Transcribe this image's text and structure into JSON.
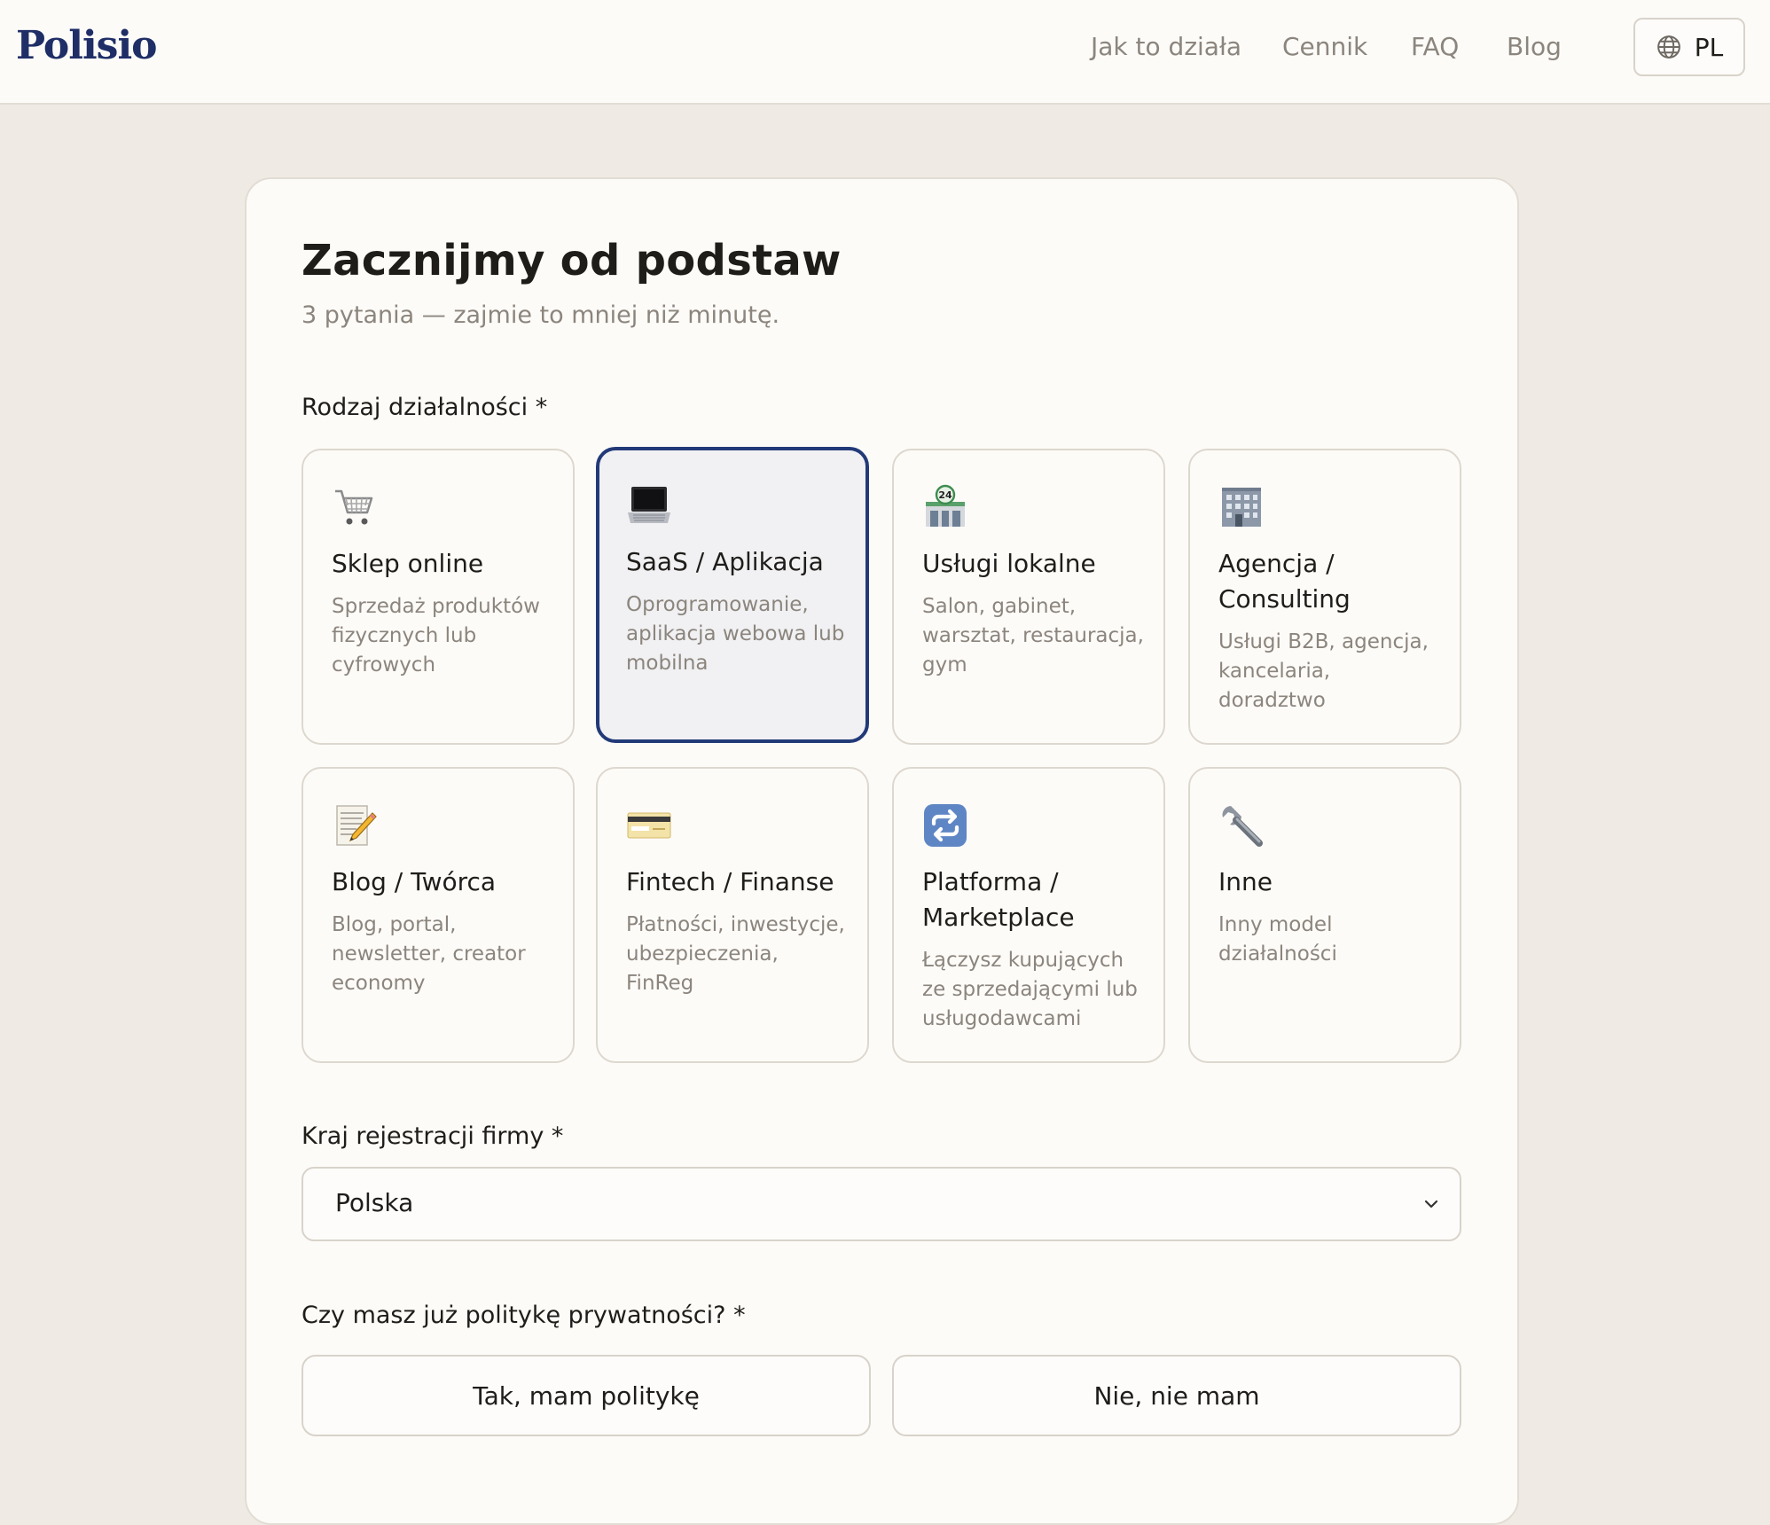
{
  "header": {
    "logo": "Polisio",
    "nav": [
      "Jak to działa",
      "Cennik",
      "FAQ",
      "Blog"
    ],
    "lang_button": "PL"
  },
  "form": {
    "title": "Zacznijmy od podstaw",
    "subtitle": "3 pytania — zajmie to mniej niż minutę.",
    "business_type_label": "Rodzaj działalności *",
    "business_types": [
      {
        "name": "Sklep online",
        "desc": "Sprzedaż produktów fizycznych lub cyfrowych",
        "icon": "shopping-cart-icon"
      },
      {
        "name": "SaaS / Aplikacja",
        "desc": "Oprogramowanie, aplikacja webowa lub mobilna",
        "icon": "laptop-icon",
        "selected": true
      },
      {
        "name": "Usługi lokalne",
        "desc": "Salon, gabinet, warsztat, restauracja, gym",
        "icon": "convenience-store-icon"
      },
      {
        "name": "Agencja / Consulting",
        "desc": "Usługi B2B, agencja, kancelaria, doradztwo",
        "icon": "office-building-icon"
      },
      {
        "name": "Blog / Twórca",
        "desc": "Blog, portal, newsletter, creator economy",
        "icon": "memo-pencil-icon"
      },
      {
        "name": "Fintech / Finanse",
        "desc": "Płatności, inwestycje, ubezpieczenia, FinReg",
        "icon": "credit-card-icon"
      },
      {
        "name": "Platforma / Marketplace",
        "desc": "Łączysz kupujących ze sprzedającymi lub usługodawcami",
        "icon": "repeat-arrows-icon"
      },
      {
        "name": "Inne",
        "desc": "Inny model działalności",
        "icon": "wrench-icon"
      }
    ],
    "country_label": "Kraj rejestracji firmy *",
    "country_value": "Polska",
    "privacy_label": "Czy masz już politykę prywatności? *",
    "privacy_options": [
      "Tak, mam politykę",
      "Nie, nie mam"
    ]
  },
  "colors": {
    "brand": "#1f2e66",
    "selected_border": "#223a78",
    "background": "#efebe4"
  }
}
